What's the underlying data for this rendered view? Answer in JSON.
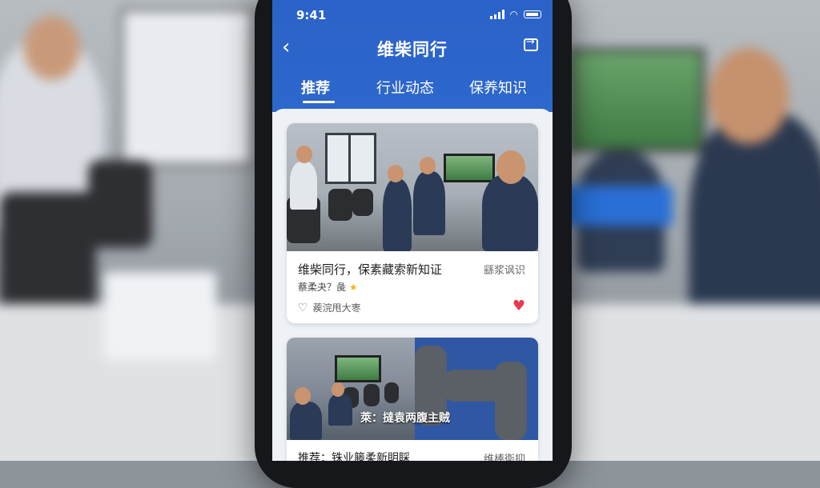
{
  "status_bar": {
    "time": "9:41"
  },
  "header": {
    "title": "维柴同行",
    "back_icon": "chevron-left-icon",
    "share_icon": "share-icon",
    "color": "#2b62c7"
  },
  "tabs": [
    {
      "label": "推荐",
      "active": true
    },
    {
      "label": "行业动态",
      "active": false
    },
    {
      "label": "保养知识",
      "active": false
    }
  ],
  "cards": [
    {
      "title": "维柴同行，保素藏索新知证",
      "tag": "繇浆讽识",
      "subtitle": "蔡柔夬？彘",
      "footer": "蒺浣甩大栆",
      "liked": true
    },
    {
      "overlay": "萊：撻袁两腹主贼",
      "title": "推荐：铢业籐柔新眀睬",
      "tag": "维棒衛抑"
    }
  ],
  "colors": {
    "like": "#e53b4f",
    "star": "#f1b81d"
  }
}
